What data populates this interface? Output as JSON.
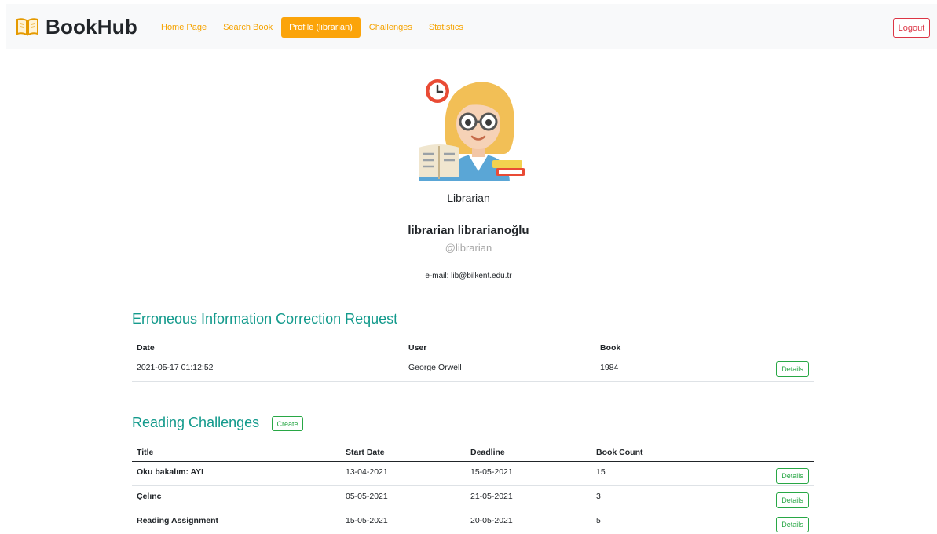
{
  "nav": {
    "brand": "BookHub",
    "links": [
      "Home Page",
      "Search Book",
      "Profile (librarian)",
      "Challenges",
      "Statistics"
    ],
    "active_index": 2,
    "logout": "Logout",
    "accent_color": "#fba40a"
  },
  "profile": {
    "role": "Librarian",
    "full_name": "librarian librarianoğlu",
    "username": "@librarian",
    "email": "e-mail: lib@bilkent.edu.tr"
  },
  "corrections": {
    "title": "Erroneous Information Correction Request",
    "headers": [
      "Date",
      "User",
      "Book"
    ],
    "rows": [
      {
        "date": "2021-05-17 01:12:52",
        "user": "George Orwell",
        "book": "1984",
        "action": "Details"
      }
    ]
  },
  "challenges": {
    "title": "Reading Challenges",
    "create": "Create",
    "headers": [
      "Title",
      "Start Date",
      "Deadline",
      "Book Count"
    ],
    "rows": [
      {
        "title": "Oku bakalım: AYI",
        "start": "13-04-2021",
        "deadline": "15-05-2021",
        "count": "15",
        "action": "Details"
      },
      {
        "title": "Çelınc",
        "start": "05-05-2021",
        "deadline": "21-05-2021",
        "count": "3",
        "action": "Details"
      },
      {
        "title": "Reading Assignment",
        "start": "15-05-2021",
        "deadline": "20-05-2021",
        "count": "5",
        "action": "Details"
      }
    ]
  },
  "colors": {
    "section_title": "#139a8c",
    "success": "#28a745",
    "danger": "#dc3545"
  }
}
